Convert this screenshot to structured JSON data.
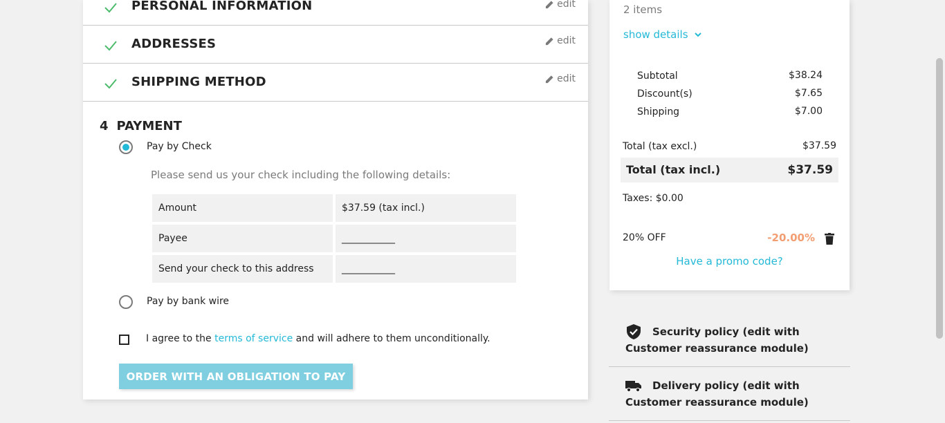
{
  "checkout": {
    "steps": [
      {
        "title": "PERSONAL INFORMATION",
        "edit": "edit"
      },
      {
        "title": "ADDRESSES",
        "edit": "edit"
      },
      {
        "title": "SHIPPING METHOD",
        "edit": "edit"
      }
    ],
    "payment": {
      "number": "4",
      "title": "PAYMENT",
      "options": [
        {
          "label": "Pay by Check",
          "selected": true
        },
        {
          "label": "Pay by bank wire",
          "selected": false
        }
      ],
      "note": "Please send us your check including the following details:",
      "details": [
        {
          "label": "Amount",
          "value": "$37.59 (tax incl.)"
        },
        {
          "label": "Payee",
          "value": "___________"
        },
        {
          "label": "Send your check to this address",
          "value": "___________"
        }
      ],
      "agree_prefix": "I agree to the",
      "agree_link": "terms of service",
      "agree_suffix": "and will adhere to them unconditionally.",
      "order_button": "ORDER WITH AN OBLIGATION TO PAY"
    }
  },
  "summary": {
    "items_count": "2 items",
    "show_details": "show details",
    "subtotal_label": "Subtotal",
    "subtotal_value": "$38.24",
    "discounts_label": "Discount(s)",
    "discounts_value": "$7.65",
    "shipping_label": "Shipping",
    "shipping_value": "$7.00",
    "total_excl_label": "Total (tax excl.)",
    "total_excl_value": "$37.59",
    "total_incl_label": "Total (tax incl.)",
    "total_incl_value": "$37.59",
    "taxes": "Taxes: $0.00",
    "voucher_name": "20% OFF",
    "voucher_value": "-20.00%",
    "promo_link": "Have a promo code?"
  },
  "reassurance": [
    {
      "icon": "shield-check-icon",
      "text": "Security policy (edit with Customer reassurance module)"
    },
    {
      "icon": "truck-icon",
      "text": "Delivery policy (edit with Customer reassurance module)"
    }
  ],
  "colors": {
    "accent": "#24b9d7",
    "check": "#4cbb6c",
    "discount": "#f39d72",
    "button": "#7fcfe0"
  }
}
